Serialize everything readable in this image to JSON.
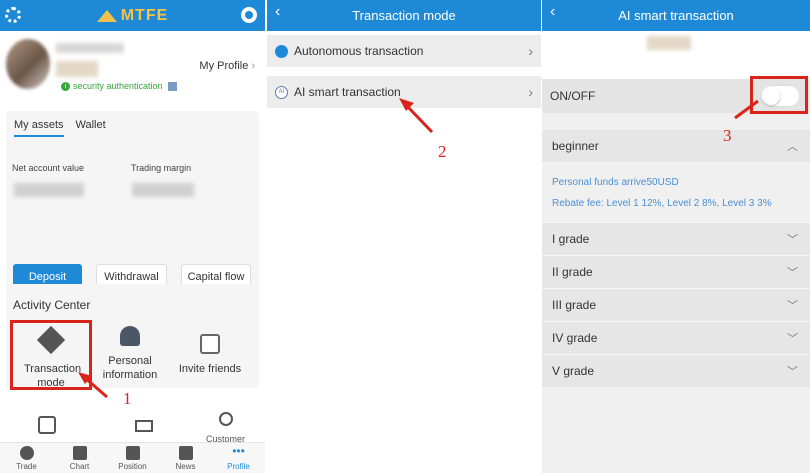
{
  "panel1": {
    "app_name": "MTFE",
    "my_profile": "My Profile",
    "security_auth": "security authentication",
    "tabs": [
      "My assets",
      "Wallet"
    ],
    "net_account_value_label": "Net account value",
    "trading_margin_label": "Trading margin",
    "buttons": {
      "deposit": "Deposit",
      "withdrawal": "Withdrawal",
      "capital_flow": "Capital flow"
    },
    "activity_title": "Activity Center",
    "activities": {
      "transaction_mode": "Transaction mode",
      "personal_info": "Personal information",
      "invite": "Invite friends"
    },
    "partial_customer": "Customer",
    "nav": [
      "Trade",
      "Chart",
      "Position",
      "News",
      "Profile"
    ],
    "annotation": "1"
  },
  "panel2": {
    "title": "Transaction mode",
    "items": [
      "Autonomous transaction",
      "AI smart transaction"
    ],
    "ai_icon_text": "AI",
    "annotation": "2"
  },
  "panel3": {
    "title": "AI smart transaction",
    "onoff_label": "ON/OFF",
    "level_title": "beginner",
    "personal_funds": "Personal funds arrive50USD",
    "rebate": "Rebate fee: Level 1 12%, Level 2 8%, Level 3 3%",
    "grades": [
      "I grade",
      "II grade",
      "III grade",
      "IV grade",
      "V grade"
    ],
    "annotation": "3"
  },
  "colors": {
    "header_blue": "#1e8ad7",
    "annotation_red": "#d9241c",
    "link_blue": "#4a90d6"
  }
}
